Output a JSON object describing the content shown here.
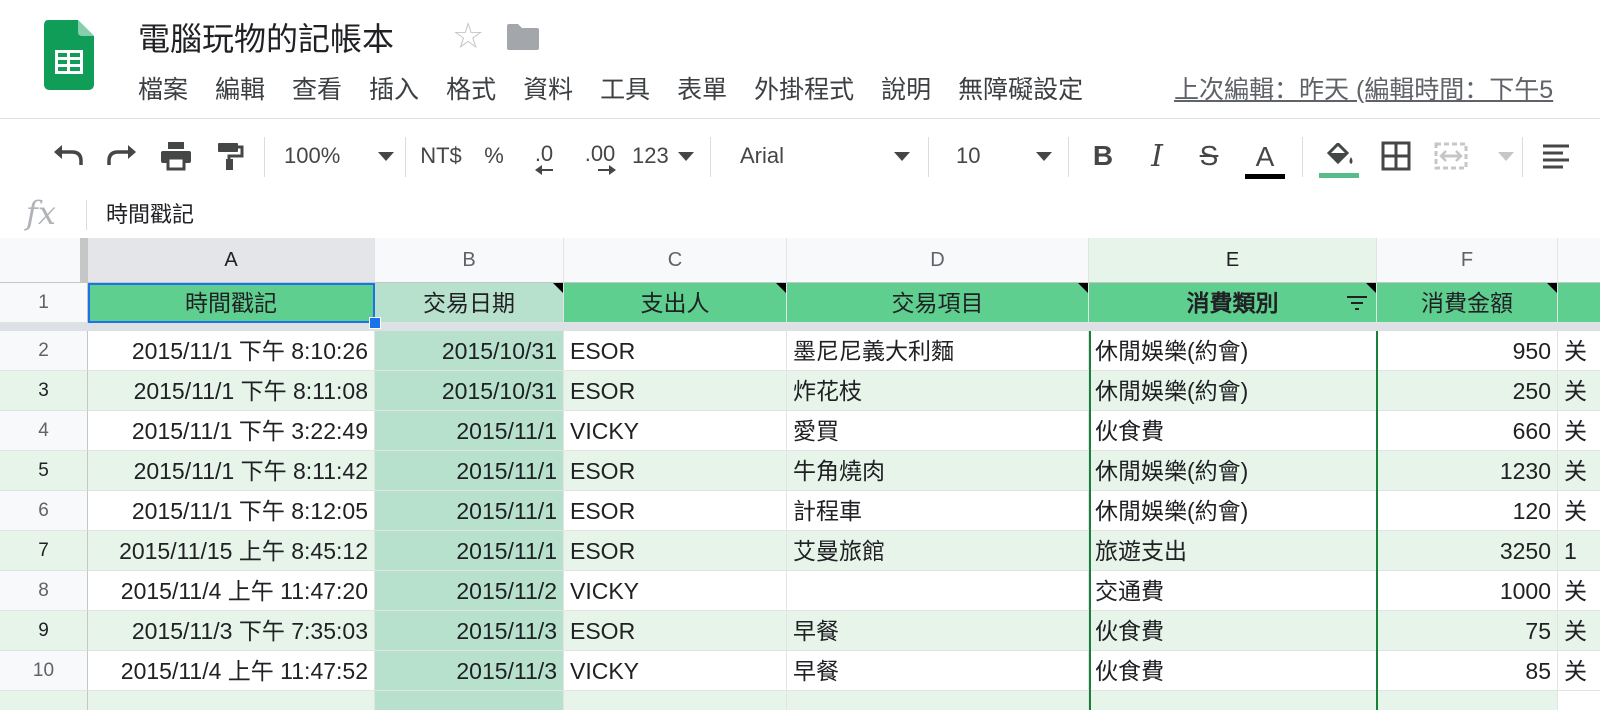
{
  "doc": {
    "title": "電腦玩物的記帳本"
  },
  "menu": [
    "檔案",
    "編輯",
    "查看",
    "插入",
    "格式",
    "資料",
    "工具",
    "表單",
    "外掛程式",
    "說明",
    "無障礙設定"
  ],
  "last_edit": "上次編輯：昨天 (編輯時間：下午5",
  "toolbar": {
    "zoom": "100%",
    "currency": "NT$",
    "percent": "%",
    "dec_decrease": ".0",
    "dec_increase": ".00",
    "more_formats": "123",
    "font": "Arial",
    "font_size": "10",
    "bold": "B",
    "italic": "I",
    "strike": "S",
    "text_color": "A",
    "accent_color": "#57bb8a"
  },
  "formula_bar": {
    "value": "時間戳記"
  },
  "colors": {
    "header_green": "#5fcf8f",
    "header_green_light": "#b7e1cd",
    "band_green": "#e6f4ea",
    "col_b_green": "#b7e1cd",
    "selection_blue": "#1a73e8"
  },
  "grid": {
    "column_letters": [
      "A",
      "B",
      "C",
      "D",
      "E",
      "F"
    ],
    "headers": [
      "時間戳記",
      "交易日期",
      "支出人",
      "交易項目",
      "消費類別",
      "消費金額"
    ],
    "row_numbers": [
      "1",
      "2",
      "3",
      "4",
      "5",
      "6",
      "7",
      "8",
      "9",
      "10"
    ],
    "rows": [
      [
        "2015/11/1 下午 8:10:26",
        "2015/10/31",
        "ESOR",
        "墨尼尼義大利麵",
        "休閒娛樂(約會)",
        "950"
      ],
      [
        "2015/11/1 下午 8:11:08",
        "2015/10/31",
        "ESOR",
        "炸花枝",
        "休閒娛樂(約會)",
        "250"
      ],
      [
        "2015/11/1 下午 3:22:49",
        "2015/11/1",
        "VICKY",
        "愛買",
        "伙食費",
        "660"
      ],
      [
        "2015/11/1 下午 8:11:42",
        "2015/11/1",
        "ESOR",
        "牛角燒肉",
        "休閒娛樂(約會)",
        "1230"
      ],
      [
        "2015/11/1 下午 8:12:05",
        "2015/11/1",
        "ESOR",
        "計程車",
        "休閒娛樂(約會)",
        "120"
      ],
      [
        "2015/11/15 上午 8:45:12",
        "2015/11/1",
        "ESOR",
        "艾曼旅館",
        "旅遊支出",
        "3250"
      ],
      [
        "2015/11/4 上午 11:47:20",
        "2015/11/2",
        "VICKY",
        "",
        "交通費",
        "1000"
      ],
      [
        "2015/11/3 下午 7:35:03",
        "2015/11/3",
        "ESOR",
        "早餐",
        "伙食費",
        "75"
      ],
      [
        "2015/11/4 上午 11:47:52",
        "2015/11/3",
        "VICKY",
        "早餐",
        "伙食費",
        "85"
      ]
    ],
    "overflow_g": [
      "关",
      "关",
      "关",
      "关",
      "关",
      "1",
      "关",
      "关",
      "关"
    ]
  }
}
